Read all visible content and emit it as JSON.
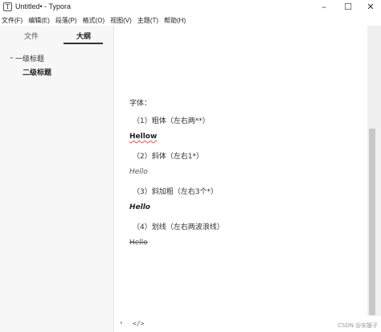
{
  "window": {
    "app_icon": "T",
    "title": "Untitled• - Typora",
    "controls": {
      "minimize": "–",
      "maximize": "☐",
      "close": "✕"
    }
  },
  "menu": [
    "文件(F)",
    "编辑(E)",
    "段落(P)",
    "格式(O)",
    "视图(V)",
    "主题(T)",
    "帮助(H)"
  ],
  "sidebar": {
    "tabs": {
      "files": "文件",
      "outline": "大纲"
    },
    "active_tab": "outline",
    "outline": {
      "chevron": "⌄",
      "h1": "一级标题",
      "h2": "二级标题"
    }
  },
  "editor": {
    "lines": [
      "字体：",
      "（1）粗体（左右两**）",
      "Hellow",
      "（2）斜体（左右1*）",
      "Hello",
      "（3）斜加粗（左右3个*）",
      "Hello",
      "（4）划线（左右两波浪线）",
      "Hello"
    ]
  },
  "footer": {
    "back_icon": "‹",
    "code_icon": "</>",
    "watermark": "CSDN @安媛子"
  },
  "icons": {
    "app": "typora-app-icon",
    "back": "chevron-left-icon",
    "code": "source-code-icon"
  }
}
